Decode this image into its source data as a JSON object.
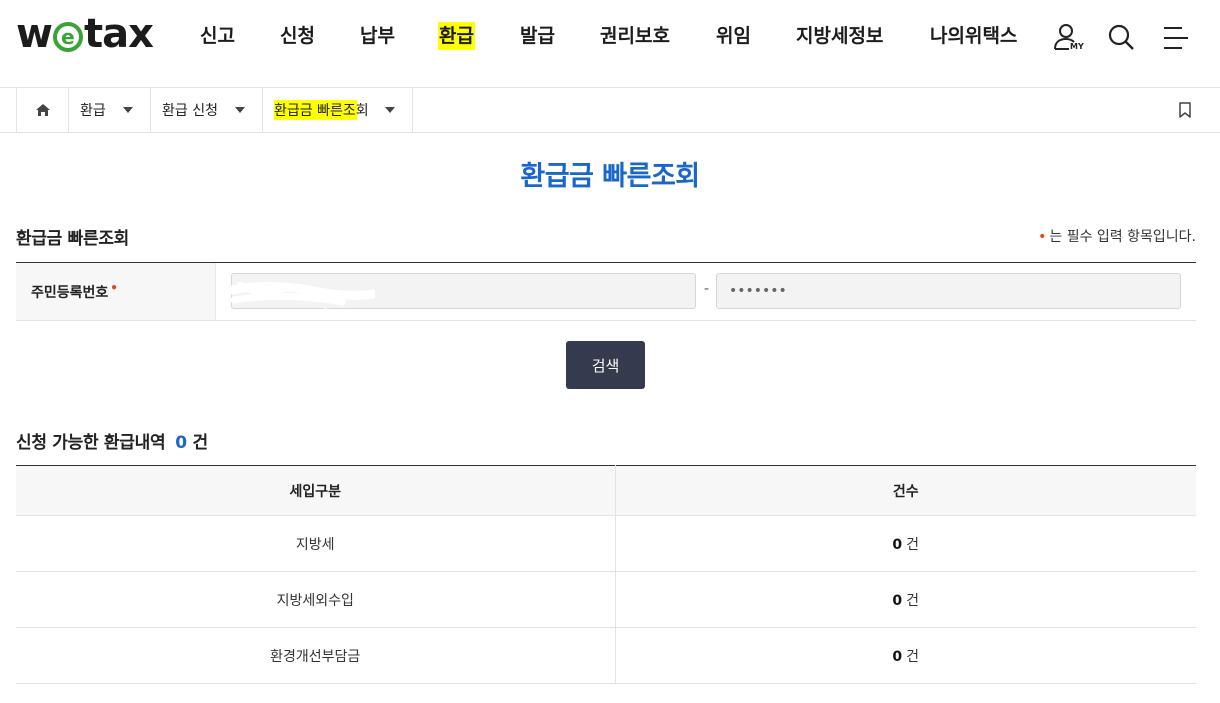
{
  "header": {
    "logo": {
      "w": "w",
      "e": "e",
      "rest": "tax"
    },
    "nav": [
      "신고",
      "신청",
      "납부",
      "환급",
      "발급",
      "권리보호",
      "위임",
      "지방세정보",
      "나의위택스"
    ],
    "nav_highlight_index": 3,
    "icons": [
      "my-page-icon",
      "search-icon",
      "menu-icon"
    ],
    "my_badge": "MY"
  },
  "breadcrumb": {
    "items": [
      "환급",
      "환급 신청",
      "환급금 빠른조회"
    ],
    "icons": [
      "home-icon",
      "bookmark-icon"
    ]
  },
  "page": {
    "title": "환급금 빠른조회",
    "section_title": "환급금 빠른조회",
    "required_note": "는 필수 입력 항목입니다.",
    "required_mark": "•"
  },
  "form": {
    "label": "주민등록번호",
    "required_mark": "•",
    "rrn_front_value": "",
    "rrn_back_value": "•••••••",
    "dash": "-"
  },
  "search_button": "검색",
  "results": {
    "title": "신청 가능한 환급내역",
    "count": "0",
    "count_unit": "건",
    "columns": [
      "세입구분",
      "건수"
    ],
    "rows": [
      {
        "category": "지방세",
        "count": "0",
        "unit": "건"
      },
      {
        "category": "지방세외수입",
        "count": "0",
        "unit": "건"
      },
      {
        "category": "환경개선부담금",
        "count": "0",
        "unit": "건"
      }
    ]
  },
  "colors": {
    "accent_blue": "#1a66c9",
    "logo_green": "#3aa335",
    "highlight_yellow": "#ffff00",
    "button_dark": "#363a4e",
    "required_red": "#e0461a"
  }
}
